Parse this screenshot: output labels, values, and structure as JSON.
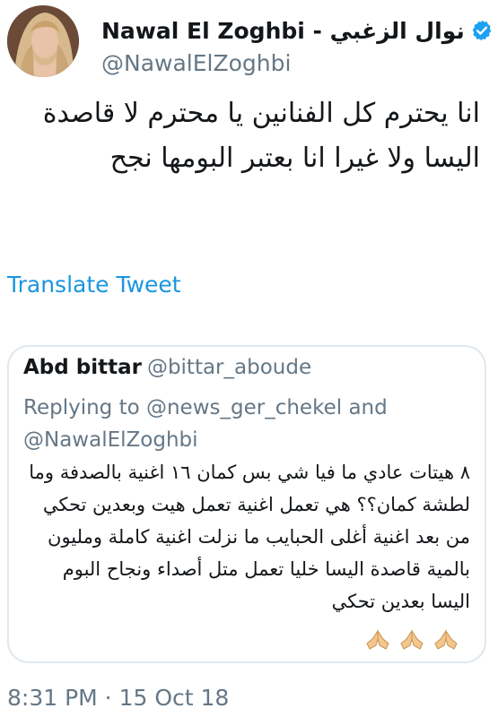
{
  "tweet": {
    "display_name": "Nawal El Zoghbi - نوال الزغبي",
    "handle": "@NawalElZoghbi",
    "text": "انا يحترم كل الفنانين يا محترم لا قاصدة اليسا ولا غيرا انا بعتبر البومها نجح",
    "translate_label": "Translate Tweet",
    "timestamp": "8:31 PM · 15 Oct 18"
  },
  "quoted": {
    "display_name": "Abd bittar",
    "handle": "@bittar_aboude",
    "replying_prefix": "Replying to",
    "replying_to_1": "@news_ger_chekel",
    "replying_and": "and",
    "replying_to_2": "@NawalElZoghbi",
    "text": "٨ هيتات عادي ما فيا شي بس كمان ١٦ اغنية بالصدفة وما لطشة كمان؟؟ هي تعمل اغنية تعمل هيت وبعدين تحكي من بعد اغنية أغلى الحبايب ما نزلت اغنية كاملة ومليون بالمية قاصدة اليسا خليا تعمل متل أصداء ونجاح البوم اليسا بعدين تحكي",
    "emojis": [
      "folded-hands-icon",
      "folded-hands-icon",
      "folded-hands-icon"
    ]
  },
  "colors": {
    "link": "#1b95e0",
    "verified": "#1da1f2",
    "muted": "#657786",
    "border": "#e1e8ed"
  }
}
